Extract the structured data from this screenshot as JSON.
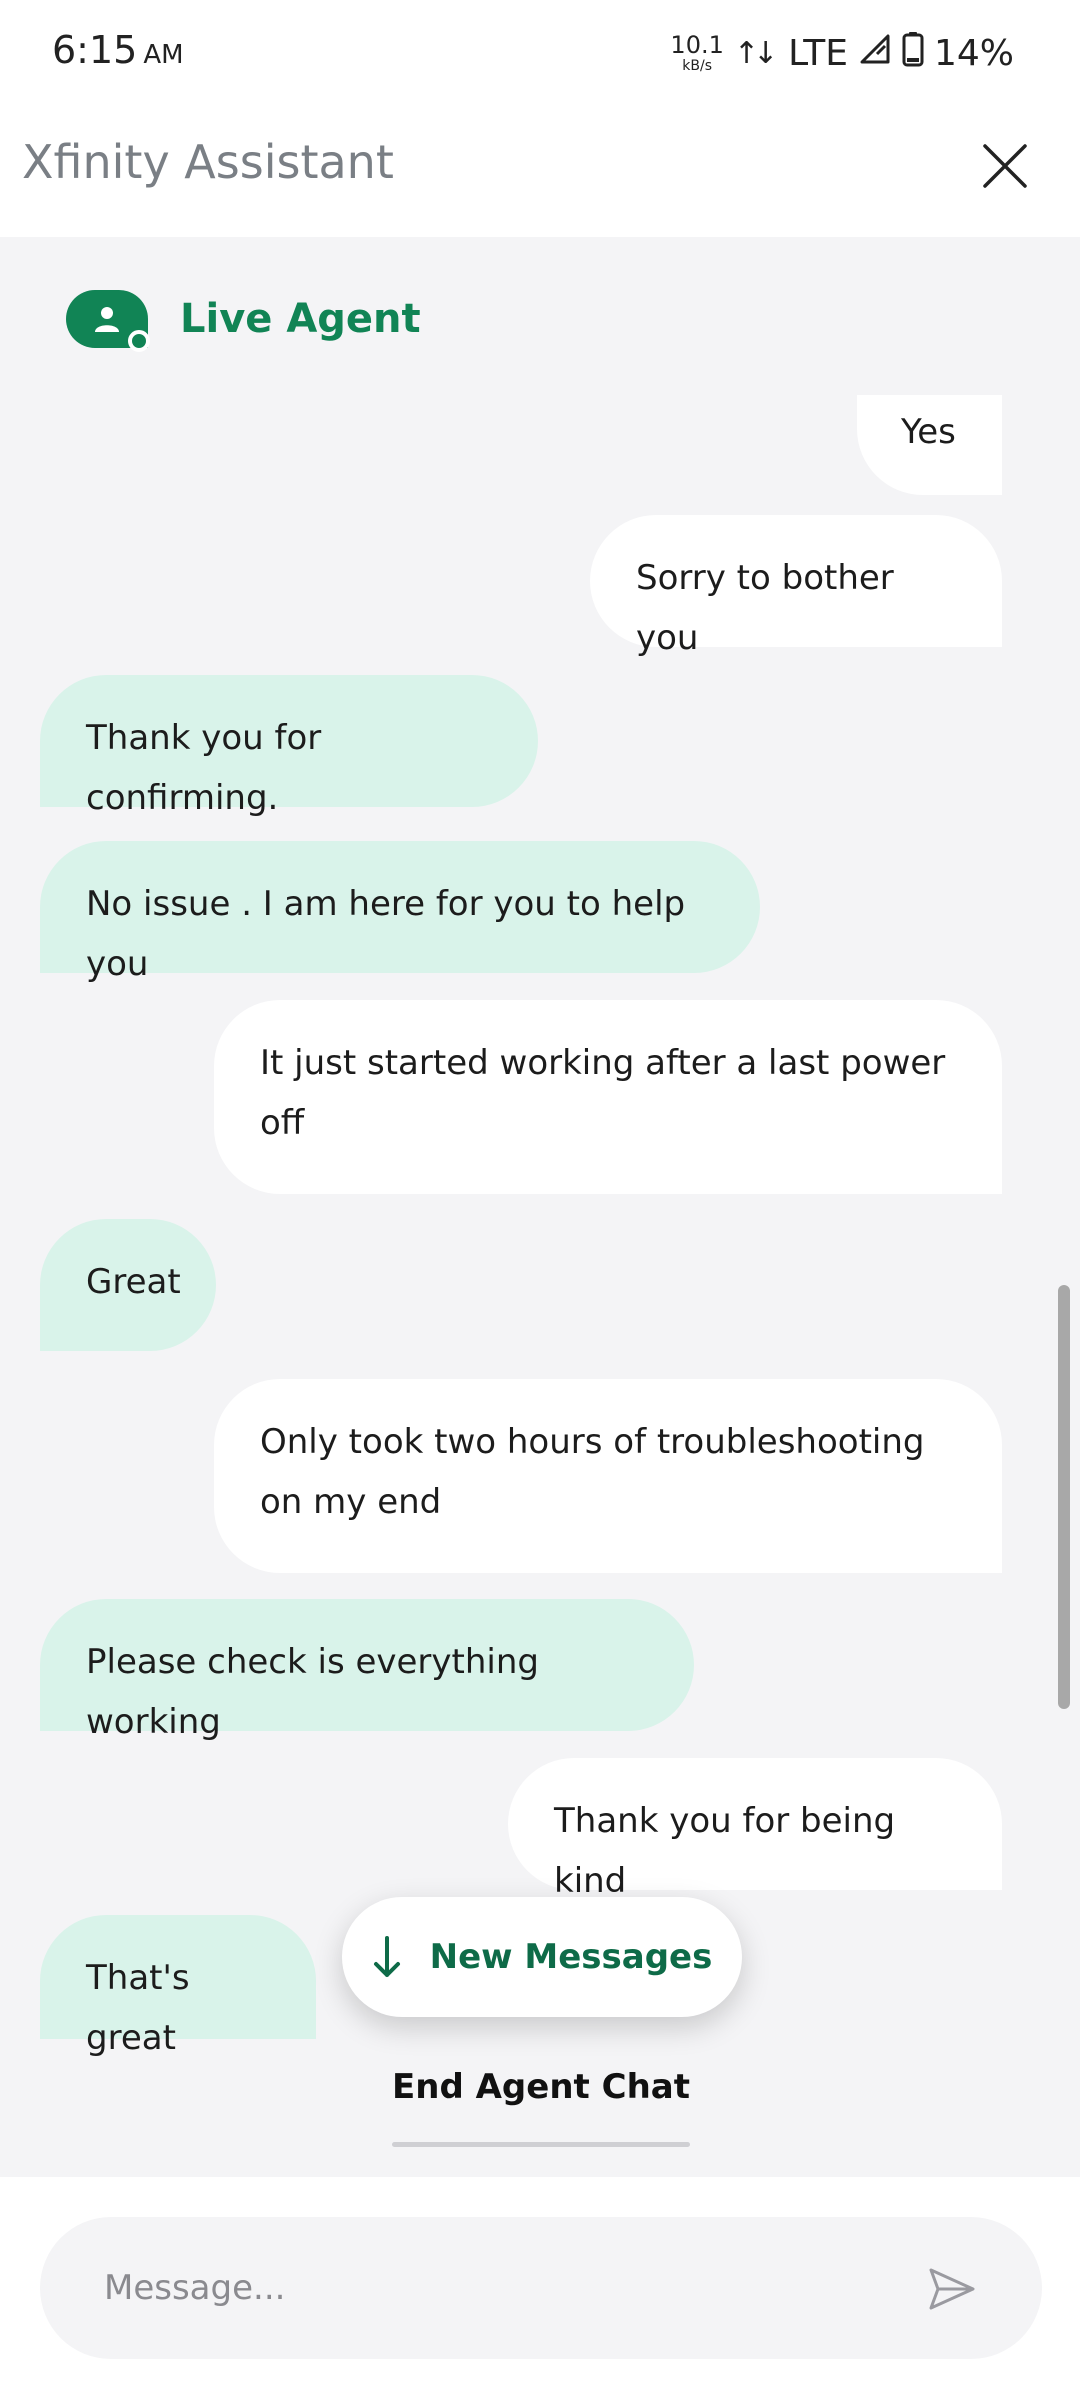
{
  "status_bar": {
    "time": "6:15",
    "ampm": "AM",
    "net_speed": "10.1",
    "net_unit": "kB/s",
    "network": "LTE",
    "battery": "14%"
  },
  "header": {
    "title": "Xfinity Assistant"
  },
  "agent": {
    "label": "Live Agent"
  },
  "messages": [
    {
      "from": "user",
      "text": "Yes"
    },
    {
      "from": "user",
      "text": "Sorry to bother you"
    },
    {
      "from": "agent",
      "text": "Thank you for confirming."
    },
    {
      "from": "agent",
      "text": "No issue . I am here for you to help you"
    },
    {
      "from": "user",
      "text": "It just started working after a last power off"
    },
    {
      "from": "agent",
      "text": "Great"
    },
    {
      "from": "user",
      "text": "Only took two hours of troubleshooting on my end"
    },
    {
      "from": "agent",
      "text": "Please check is everything working"
    },
    {
      "from": "user",
      "text": "Thank you for being kind"
    },
    {
      "from": "agent",
      "text": "That's great"
    }
  ],
  "new_messages_button": {
    "label": "New Messages"
  },
  "end_chat": {
    "label": "End Agent Chat"
  },
  "composer": {
    "placeholder": "Message..."
  },
  "colors": {
    "brand_green": "#118455",
    "agent_bubble": "#d9f3ea",
    "user_bubble": "#ffffff",
    "chat_background": "#f4f4f6"
  },
  "icons": {
    "close": "close-icon",
    "send": "send-icon",
    "avatar": "person-icon",
    "new_messages": "arrow-down-icon"
  }
}
